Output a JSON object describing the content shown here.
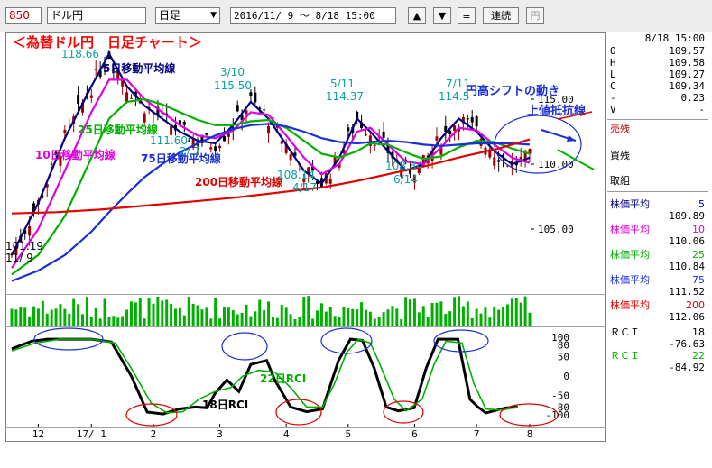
{
  "toolbar": {
    "code": "850",
    "name": "ドル円",
    "period": "日足",
    "range": "2016/11/ 9 ～  8/18 15:00",
    "btn_up": "▲",
    "btn_down": "▼",
    "btn_menu": "≡",
    "btn_continuous": "連続",
    "btn_yen": "円"
  },
  "chart_data": {
    "type": "line",
    "title": "＜為替ドル円　日足チャート＞",
    "price_axis": {
      "ticks": [
        "115.00",
        "110.00",
        "105.00"
      ],
      "ylim": [
        100,
        120
      ]
    },
    "x_ticks": [
      "12",
      "17/ 1",
      "2",
      "3",
      "4",
      "5",
      "6",
      "7",
      "8"
    ],
    "rci_axis": {
      "ticks": [
        "100",
        "80",
        "50",
        "0",
        "-50",
        "-80",
        "-100"
      ],
      "ylim": [
        -100,
        100
      ]
    },
    "series": [
      {
        "name": "5日移動平均線",
        "color": "#000080",
        "label": "5日移動平均線",
        "points": [
          [
            0,
            103
          ],
          [
            6,
            107
          ],
          [
            12,
            112
          ],
          [
            18,
            116
          ],
          [
            22,
            118.5
          ],
          [
            26,
            116
          ],
          [
            30,
            114.5
          ],
          [
            34,
            113.5
          ],
          [
            38,
            112.5
          ],
          [
            42,
            111.8
          ],
          [
            46,
            111.6
          ],
          [
            50,
            113
          ],
          [
            54,
            114.8
          ],
          [
            58,
            113.5
          ],
          [
            62,
            111.5
          ],
          [
            66,
            109.5
          ],
          [
            70,
            108.5
          ],
          [
            74,
            110.5
          ],
          [
            78,
            113.5
          ],
          [
            81,
            112.5
          ],
          [
            85,
            111
          ],
          [
            89,
            109.5
          ],
          [
            93,
            110
          ],
          [
            97,
            112
          ],
          [
            101,
            113.5
          ],
          [
            105,
            112.5
          ],
          [
            109,
            111
          ],
          [
            113,
            110
          ],
          [
            117,
            110.5
          ]
        ]
      },
      {
        "name": "10日移動平均線",
        "color": "#e000e0",
        "label": "10日移動平均線",
        "points": [
          [
            0,
            102
          ],
          [
            6,
            105
          ],
          [
            12,
            109.5
          ],
          [
            18,
            114
          ],
          [
            22,
            116.5
          ],
          [
            26,
            116.5
          ],
          [
            30,
            115
          ],
          [
            34,
            114
          ],
          [
            38,
            113
          ],
          [
            42,
            112.2
          ],
          [
            46,
            112
          ],
          [
            50,
            112.6
          ],
          [
            54,
            114
          ],
          [
            58,
            113.8
          ],
          [
            62,
            112.2
          ],
          [
            66,
            110.5
          ],
          [
            70,
            109.2
          ],
          [
            74,
            110
          ],
          [
            78,
            112.5
          ],
          [
            81,
            112.8
          ],
          [
            85,
            111.5
          ],
          [
            89,
            110.2
          ],
          [
            93,
            110
          ],
          [
            97,
            111.3
          ],
          [
            101,
            112.8
          ],
          [
            105,
            112.6
          ],
          [
            109,
            111.5
          ],
          [
            113,
            110.5
          ],
          [
            117,
            110.1
          ]
        ]
      },
      {
        "name": "25日移動平均線",
        "color": "#00b000",
        "label": "25日移動平均線",
        "points": [
          [
            0,
            101.5
          ],
          [
            6,
            103
          ],
          [
            12,
            106
          ],
          [
            18,
            110.5
          ],
          [
            22,
            113.5
          ],
          [
            26,
            114.8
          ],
          [
            30,
            115
          ],
          [
            34,
            114.6
          ],
          [
            38,
            114
          ],
          [
            42,
            113.4
          ],
          [
            46,
            113
          ],
          [
            50,
            113
          ],
          [
            54,
            113.3
          ],
          [
            58,
            113.4
          ],
          [
            62,
            112.8
          ],
          [
            66,
            111.8
          ],
          [
            70,
            110.8
          ],
          [
            74,
            110.5
          ],
          [
            78,
            111
          ],
          [
            81,
            111.6
          ],
          [
            85,
            111.5
          ],
          [
            89,
            110.9
          ],
          [
            93,
            110.4
          ],
          [
            97,
            110.6
          ],
          [
            101,
            111.3
          ],
          [
            105,
            111.8
          ],
          [
            109,
            111.7
          ],
          [
            113,
            111.2
          ],
          [
            117,
            110.8
          ]
        ]
      },
      {
        "name": "75日移動平均線",
        "color": "#1a2fd6",
        "label": "75日移動平均線",
        "points": [
          [
            0,
            101
          ],
          [
            6,
            101.8
          ],
          [
            12,
            103
          ],
          [
            18,
            104.8
          ],
          [
            22,
            106.3
          ],
          [
            26,
            107.7
          ],
          [
            30,
            109
          ],
          [
            34,
            110
          ],
          [
            38,
            110.9
          ],
          [
            42,
            111.6
          ],
          [
            46,
            112.2
          ],
          [
            50,
            112.7
          ],
          [
            54,
            113
          ],
          [
            58,
            113.1
          ],
          [
            62,
            112.9
          ],
          [
            66,
            112.5
          ],
          [
            70,
            112
          ],
          [
            74,
            111.7
          ],
          [
            78,
            111.6
          ],
          [
            81,
            111.7
          ],
          [
            85,
            111.8
          ],
          [
            89,
            111.7
          ],
          [
            93,
            111.5
          ],
          [
            97,
            111.4
          ],
          [
            101,
            111.5
          ],
          [
            105,
            111.6
          ],
          [
            109,
            111.6
          ],
          [
            113,
            111.6
          ],
          [
            117,
            111.5
          ]
        ]
      },
      {
        "name": "200日移動平均線",
        "color": "#e00000",
        "label": "200日移動平均線",
        "points": [
          [
            0,
            106.2
          ],
          [
            10,
            106.3
          ],
          [
            20,
            106.5
          ],
          [
            30,
            106.8
          ],
          [
            40,
            107.1
          ],
          [
            50,
            107.4
          ],
          [
            60,
            107.8
          ],
          [
            70,
            108.2
          ],
          [
            78,
            108.7
          ],
          [
            86,
            109.3
          ],
          [
            94,
            109.9
          ],
          [
            102,
            110.6
          ],
          [
            110,
            111.2
          ],
          [
            117,
            111.9
          ]
        ]
      }
    ],
    "rci_series": [
      {
        "name": "18日RCI",
        "color": "#000000",
        "label": "18日RCI",
        "points": [
          [
            0,
            70
          ],
          [
            5,
            90
          ],
          [
            9,
            95
          ],
          [
            13,
            95
          ],
          [
            20,
            95
          ],
          [
            25,
            88
          ],
          [
            30,
            0
          ],
          [
            34,
            -93
          ],
          [
            38,
            -98
          ],
          [
            42,
            -85
          ],
          [
            46,
            -80
          ],
          [
            49,
            -82
          ],
          [
            51,
            -45
          ],
          [
            54,
            -10
          ],
          [
            57,
            -40
          ],
          [
            60,
            30
          ],
          [
            64,
            40
          ],
          [
            66,
            -10
          ],
          [
            70,
            -80
          ],
          [
            74,
            -92
          ],
          [
            78,
            -85
          ],
          [
            82,
            40
          ],
          [
            85,
            95
          ],
          [
            88,
            92
          ],
          [
            91,
            20
          ],
          [
            94,
            -80
          ],
          [
            97,
            -90
          ],
          [
            101,
            -82
          ],
          [
            104,
            20
          ],
          [
            107,
            95
          ],
          [
            112,
            95
          ],
          [
            115,
            -60
          ],
          [
            117,
            -80
          ],
          [
            119,
            -95
          ],
          [
            124,
            -82
          ],
          [
            127,
            -80
          ]
        ]
      },
      {
        "name": "22日RCI",
        "color": "#00b000",
        "label": "22日RCI",
        "points": [
          [
            0,
            65
          ],
          [
            6,
            85
          ],
          [
            12,
            95
          ],
          [
            20,
            95
          ],
          [
            26,
            85
          ],
          [
            30,
            20
          ],
          [
            35,
            -70
          ],
          [
            39,
            -95
          ],
          [
            43,
            -92
          ],
          [
            47,
            -60
          ],
          [
            51,
            -40
          ],
          [
            55,
            -30
          ],
          [
            58,
            0
          ],
          [
            62,
            15
          ],
          [
            66,
            10
          ],
          [
            70,
            -30
          ],
          [
            74,
            -80
          ],
          [
            78,
            -80
          ],
          [
            81,
            -20
          ],
          [
            84,
            60
          ],
          [
            87,
            95
          ],
          [
            90,
            85
          ],
          [
            92,
            40
          ],
          [
            96,
            -60
          ],
          [
            99,
            -90
          ],
          [
            103,
            -60
          ],
          [
            106,
            30
          ],
          [
            109,
            90
          ],
          [
            113,
            85
          ],
          [
            116,
            -20
          ],
          [
            119,
            -85
          ],
          [
            123,
            -88
          ],
          [
            127,
            -80
          ]
        ]
      }
    ],
    "annotations": {
      "high_1": {
        "value": "118.66"
      },
      "low_start": {
        "value": "101.19",
        "date": "11/ 9"
      },
      "peak_mar": {
        "date": "3/10",
        "value": "115.50"
      },
      "trough_feb": {
        "value": "111.60",
        "date": "2/ 7"
      },
      "peak_may": {
        "date": "5/11",
        "value": "114.37"
      },
      "trough_apr": {
        "value": "108.14",
        "date": "4/17"
      },
      "trough_jun": {
        "value": "108.84",
        "date": "6/14"
      },
      "peak_jul": {
        "date": "7/11",
        "value": "114.5"
      },
      "note_yen_shift": "円高シフトの動き",
      "note_resistance": "上値抵抗線",
      "rci18_label": "18日RCI",
      "rci22_label": "22日RCI"
    }
  },
  "side_panel": {
    "date": "8/18 15:00",
    "ohlc": [
      {
        "label": "O",
        "value": "109.57"
      },
      {
        "label": "H",
        "value": "109.58"
      },
      {
        "label": "L",
        "value": "109.27"
      },
      {
        "label": "C",
        "value": "109.34"
      },
      {
        "label": "-",
        "value": "0.23"
      },
      {
        "label": "V",
        "value": "-"
      }
    ],
    "sell_rest": "売残",
    "buy_rest": "買残",
    "trading": "取組",
    "ma": [
      {
        "label": "株価平均",
        "period": "5",
        "value": "109.89",
        "color": "#000080"
      },
      {
        "label": "株価平均",
        "period": "10",
        "value": "110.06",
        "color": "#e000e0"
      },
      {
        "label": "株価平均",
        "period": "25",
        "value": "110.84",
        "color": "#00b000"
      },
      {
        "label": "株価平均",
        "period": "75",
        "value": "111.52",
        "color": "#1a2fd6"
      },
      {
        "label": "株価平均",
        "period": "200",
        "value": "112.06",
        "color": "#e00000"
      }
    ],
    "rci": [
      {
        "label": "ＲＣＩ",
        "period": "18",
        "value": "-76.63",
        "color": "#000000"
      },
      {
        "label": "ＲＣＩ",
        "period": "22",
        "value": "-84.92",
        "color": "#00b000"
      }
    ]
  }
}
